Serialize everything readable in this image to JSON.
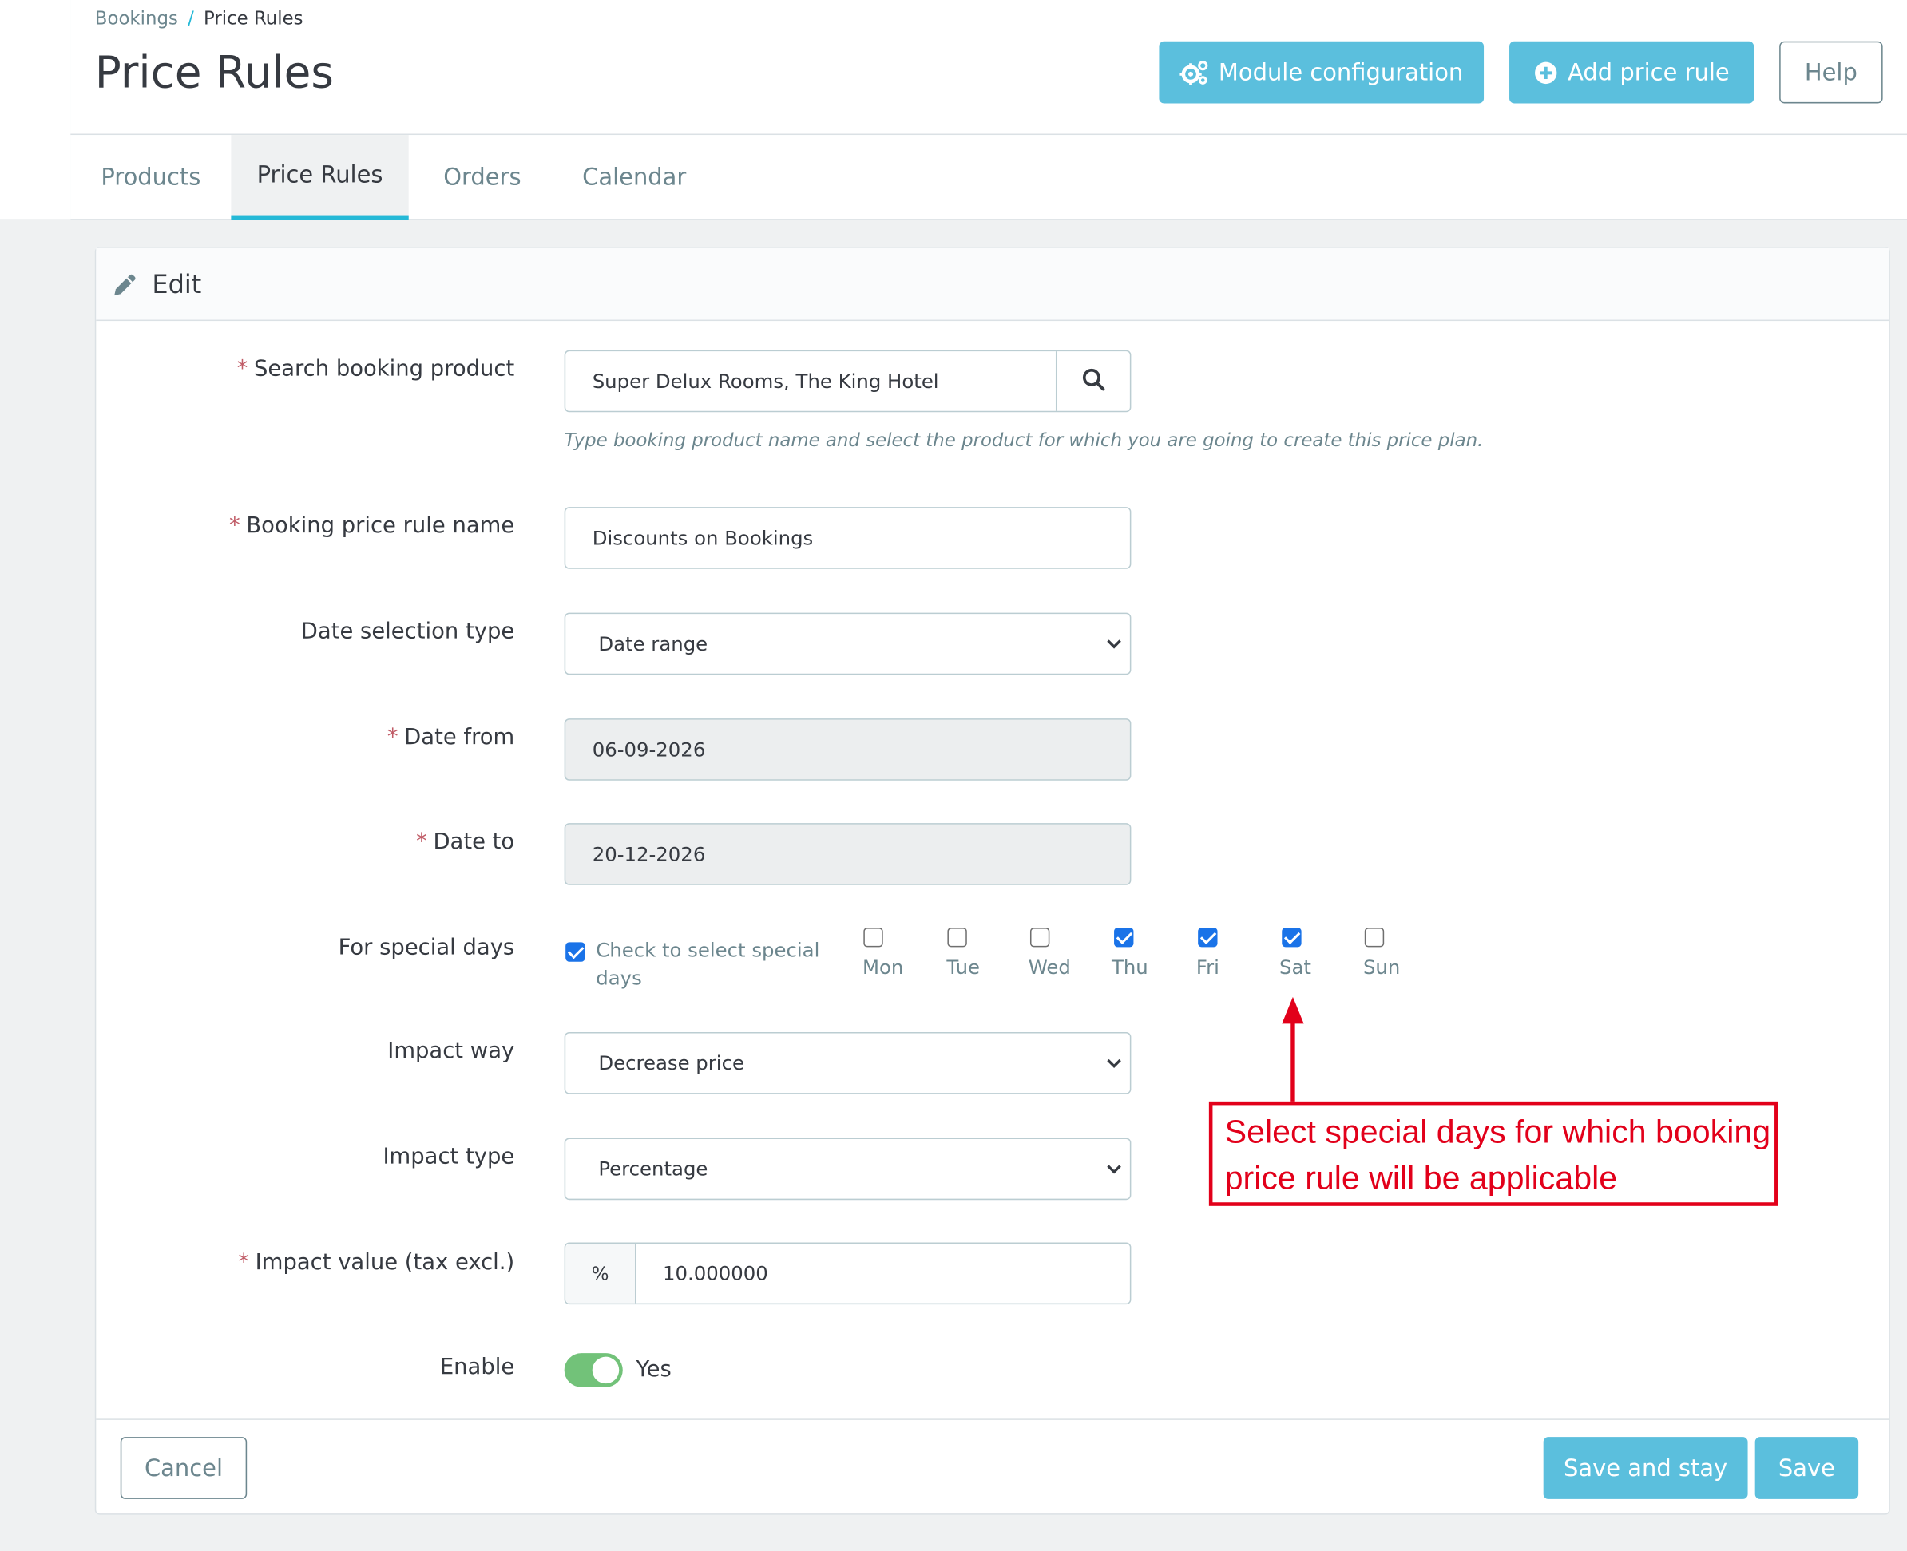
{
  "breadcrumb": {
    "parent": "Bookings",
    "separator": "/",
    "current": "Price Rules"
  },
  "page_title": "Price Rules",
  "header_buttons": {
    "module_configuration": "Module configuration",
    "add_price_rule": "Add price rule",
    "help": "Help"
  },
  "tabs": [
    {
      "label": "Products",
      "active": false
    },
    {
      "label": "Price Rules",
      "active": true
    },
    {
      "label": "Orders",
      "active": false
    },
    {
      "label": "Calendar",
      "active": false
    }
  ],
  "card": {
    "title": "Edit"
  },
  "form": {
    "search_product": {
      "label": "Search booking product",
      "required": "*",
      "value": "Super Delux Rooms, The King Hotel",
      "help": "Type booking product name and select the product for which you are going to create this price plan."
    },
    "rule_name": {
      "label": "Booking price rule name",
      "required": "*",
      "value": "Discounts on Bookings"
    },
    "date_selection_type": {
      "label": "Date selection type",
      "value": "Date range"
    },
    "date_from": {
      "label": "Date from",
      "required": "*",
      "value": "06-09-2026"
    },
    "date_to": {
      "label": "Date to",
      "required": "*",
      "value": "20-12-2026"
    },
    "special_days": {
      "label": "For special days",
      "checkbox_label": "Check to select special days",
      "checked": true,
      "days": [
        {
          "label": "Mon",
          "checked": false
        },
        {
          "label": "Tue",
          "checked": false
        },
        {
          "label": "Wed",
          "checked": false
        },
        {
          "label": "Thu",
          "checked": true
        },
        {
          "label": "Fri",
          "checked": true
        },
        {
          "label": "Sat",
          "checked": true
        },
        {
          "label": "Sun",
          "checked": false
        }
      ]
    },
    "impact_way": {
      "label": "Impact way",
      "value": "Decrease price"
    },
    "impact_type": {
      "label": "Impact type",
      "value": "Percentage"
    },
    "impact_value": {
      "label": "Impact value (tax excl.)",
      "required": "*",
      "unit": "%",
      "value": "10.000000"
    },
    "enable": {
      "label": "Enable",
      "value": "Yes",
      "on": true
    }
  },
  "footer": {
    "cancel": "Cancel",
    "save_and_stay": "Save and stay",
    "save": "Save"
  },
  "annotation": {
    "text": "Select special days for which booking price rule will be applicable",
    "color": "#e2001a"
  },
  "colors": {
    "primary": "#5bbfdd",
    "tab_accent": "#25b9d7",
    "toggle_on": "#72c279",
    "required": "#c05c67"
  }
}
